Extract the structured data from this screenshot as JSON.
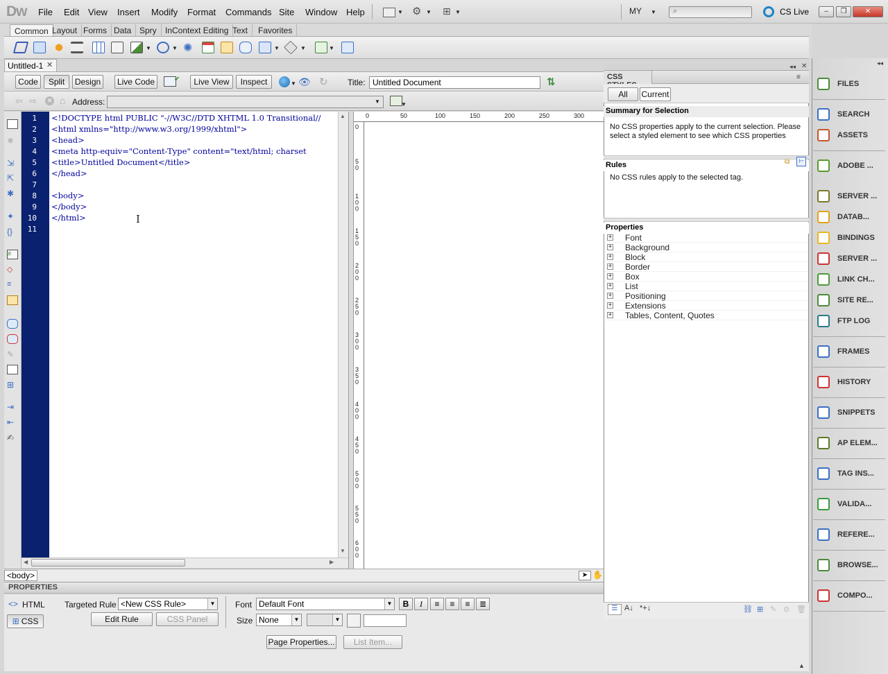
{
  "app": {
    "logo": "Dw"
  },
  "menu": [
    "File",
    "Edit",
    "View",
    "Insert",
    "Modify",
    "Format",
    "Commands",
    "Site",
    "Window",
    "Help"
  ],
  "header": {
    "workspace": "MY",
    "cs_live": "CS Live"
  },
  "insert_tabs": [
    "Common",
    "Layout",
    "Forms",
    "Data",
    "Spry",
    "InContext Editing",
    "Text",
    "Favorites"
  ],
  "document": {
    "tab": "Untitled-1",
    "toolbar": {
      "code": "Code",
      "split": "Split",
      "design": "Design",
      "live_code": "Live Code",
      "live_view": "Live View",
      "inspect": "Inspect",
      "title_label": "Title:",
      "title_value": "Untitled Document"
    },
    "address_label": "Address:"
  },
  "code": {
    "line_numbers": [
      "1",
      "2",
      "3",
      "4",
      "5",
      "6",
      "7",
      "8",
      "9",
      "10",
      "11"
    ],
    "lines": [
      "<!DOCTYPE html PUBLIC \"-//W3C//DTD XHTML 1.0 Transitional//",
      "<html xmlns=\"http://www.w3.org/1999/xhtml\">",
      "<head>",
      "<meta http-equiv=\"Content-Type\" content=\"text/html; charset",
      "<title>Untitled Document</title>",
      "</head>",
      "",
      "<body>",
      "</body>",
      "</html>",
      ""
    ]
  },
  "ruler": {
    "top": [
      "0",
      "50",
      "100",
      "150",
      "200",
      "250",
      "300"
    ],
    "left": [
      "0",
      "50",
      "100",
      "150",
      "200",
      "250",
      "300",
      "350",
      "400",
      "450",
      "500",
      "550",
      "600"
    ]
  },
  "status": {
    "tag": "<body>"
  },
  "properties": {
    "title": "PROPERTIES",
    "html": "HTML",
    "css": "CSS",
    "targeted_rule_label": "Targeted Rule",
    "targeted_rule_value": "<New CSS Rule>",
    "edit_rule": "Edit Rule",
    "css_panel": "CSS Panel",
    "font_label": "Font",
    "font_value": "Default Font",
    "size_label": "Size",
    "size_value": "None",
    "page_properties": "Page Properties...",
    "list_item": "List Item..."
  },
  "css_styles": {
    "title": "CSS STYLES",
    "all": "All",
    "current": "Current",
    "summary_head": "Summary for Selection",
    "summary_text": "No CSS properties apply to the current selection.  Please select a styled element to see which CSS properties",
    "rules_head": "Rules",
    "rules_text": "No CSS rules apply to the selected tag.",
    "properties_head": "Properties",
    "properties": [
      "Font",
      "Background",
      "Block",
      "Border",
      "Box",
      "List",
      "Positioning",
      "Extensions",
      "Tables, Content, Quotes"
    ]
  },
  "dock": [
    {
      "label": "FILES",
      "icon": "files-icon"
    },
    {
      "label": "SEARCH",
      "icon": "search-icon"
    },
    {
      "label": "ASSETS",
      "icon": "assets-icon"
    },
    {
      "label": "ADOBE ...",
      "icon": "adobe-browserlab-icon"
    },
    {
      "label": "SERVER ...",
      "icon": "server-behaviors-icon"
    },
    {
      "label": "DATAB...",
      "icon": "database-icon"
    },
    {
      "label": "BINDINGS",
      "icon": "bindings-icon"
    },
    {
      "label": "SERVER ...",
      "icon": "server-icon"
    },
    {
      "label": "LINK CH...",
      "icon": "link-checker-icon"
    },
    {
      "label": "SITE RE...",
      "icon": "site-reports-icon"
    },
    {
      "label": "FTP LOG",
      "icon": "ftp-log-icon"
    },
    {
      "label": "FRAMES",
      "icon": "frames-icon"
    },
    {
      "label": "HISTORY",
      "icon": "history-icon"
    },
    {
      "label": "SNIPPETS",
      "icon": "snippets-icon"
    },
    {
      "label": "AP ELEM...",
      "icon": "ap-elements-icon"
    },
    {
      "label": "TAG INS...",
      "icon": "tag-inspector-icon"
    },
    {
      "label": "VALIDA...",
      "icon": "validation-icon"
    },
    {
      "label": "REFERE...",
      "icon": "reference-icon"
    },
    {
      "label": "BROWSE...",
      "icon": "browser-compat-icon"
    },
    {
      "label": "COMPO...",
      "icon": "components-icon"
    }
  ]
}
